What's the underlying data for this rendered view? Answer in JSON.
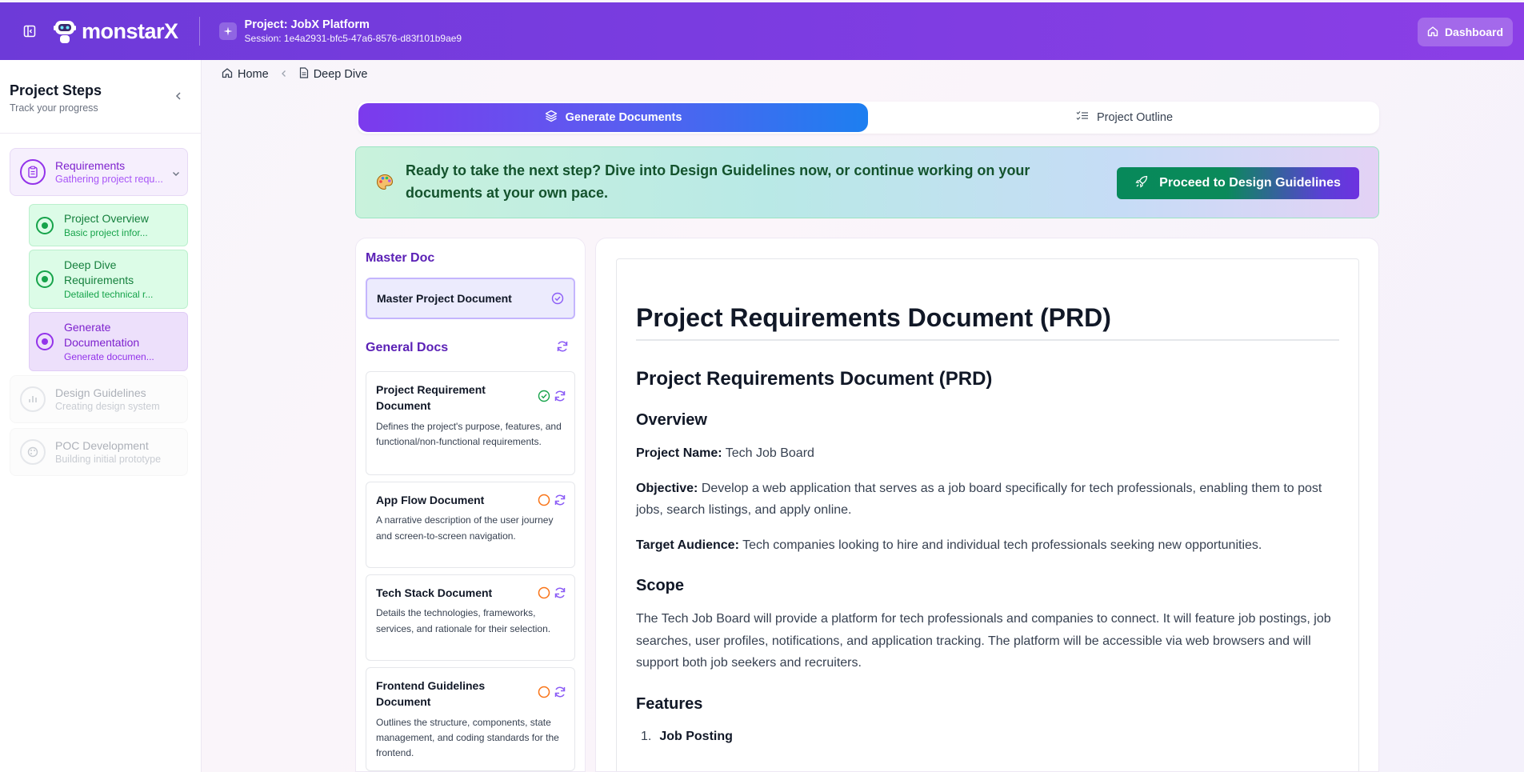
{
  "header": {
    "brand": "monstar",
    "brand_x": "X",
    "project_title": "Project: JobX Platform",
    "session": "Session: 1e4a2931-bfc5-47a6-8576-d83f101b9ae9",
    "dashboard_label": "Dashboard"
  },
  "sidebar": {
    "title": "Project Steps",
    "subtitle": "Track your progress",
    "steps": [
      {
        "label": "Requirements",
        "desc": "Gathering project requ...",
        "color": "#7e22ce"
      },
      {
        "label": "Design Guidelines",
        "desc": "Creating design system"
      },
      {
        "label": "POC Development",
        "desc": "Building initial prototype"
      }
    ],
    "substeps": [
      {
        "label": "Project Overview",
        "desc": "Basic project infor...",
        "color": "#15803d"
      },
      {
        "label": "Deep Dive Requirements",
        "label_line1": "Deep Dive",
        "label_line2": "Requirements",
        "desc": "Detailed technical r...",
        "color": "#15803d"
      },
      {
        "label": "Generate Documentation",
        "label_line1": "Generate",
        "label_line2": "Documentation",
        "desc": "Generate documen...",
        "color": "#7e22ce"
      }
    ]
  },
  "breadcrumb": {
    "home": "Home",
    "current": "Deep Dive"
  },
  "tabs": {
    "generate": "Generate Documents",
    "outline": "Project Outline"
  },
  "banner": {
    "text": "Ready to take the next step? Dive into Design Guidelines now, or continue working on your documents at your own pace.",
    "button": "Proceed to Design Guidelines"
  },
  "docs": {
    "master_heading": "Master Doc",
    "master_title": "Master Project Document",
    "general_heading": "General Docs",
    "items": [
      {
        "title": "Project Requirement Document",
        "desc": "Defines the project's purpose, features, and functional/non-functional requirements.",
        "status": "complete"
      },
      {
        "title": "App Flow Document",
        "desc": "A narrative description of the user journey and screen-to-screen navigation.",
        "status": "pending"
      },
      {
        "title": "Tech Stack Document",
        "desc": "Details the technologies, frameworks, services, and rationale for their selection.",
        "status": "pending"
      },
      {
        "title": "Frontend Guidelines Document",
        "desc": "Outlines the structure, components, state management, and coding standards for the frontend.",
        "status": "pending"
      }
    ]
  },
  "document": {
    "h1": "Project Requirements Document (PRD)",
    "h2": "Project Requirements Document (PRD)",
    "overview_heading": "Overview",
    "project_name_label": "Project Name:",
    "project_name": "Tech Job Board",
    "objective_label": "Objective:",
    "objective": "Develop a web application that serves as a job board specifically for tech professionals, enabling them to post jobs, search listings, and apply online.",
    "audience_label": "Target Audience:",
    "audience": "Tech companies looking to hire and individual tech professionals seeking new opportunities.",
    "scope_heading": "Scope",
    "scope_text": "The Tech Job Board will provide a platform for tech professionals and companies to connect. It will feature job postings, job searches, user profiles, notifications, and application tracking. The platform will be accessible via web browsers and will support both job seekers and recruiters.",
    "features_heading": "Features",
    "feature_1_num": "1.",
    "feature_1": "Job Posting"
  },
  "colors": {
    "header_gradient_start": "#6d3ad8",
    "header_gradient_end": "#8b3fe6",
    "accent_purple": "#7c3aed",
    "accent_blue": "#1d7ff0",
    "success_green": "#16a34a",
    "pending_orange": "#f97316"
  },
  "icons": {
    "sidebar_toggle": "sidebar-toggle-icon",
    "logo": "robot-logo-icon",
    "project": "sparkle-icon",
    "dashboard": "home-icon",
    "requirements": "clipboard-icon",
    "design": "chart-icon",
    "poc": "palette-icon",
    "banner": "palette-icon",
    "proceed": "rocket-icon",
    "generate_tab": "layers-icon",
    "outline_tab": "list-check-icon"
  }
}
